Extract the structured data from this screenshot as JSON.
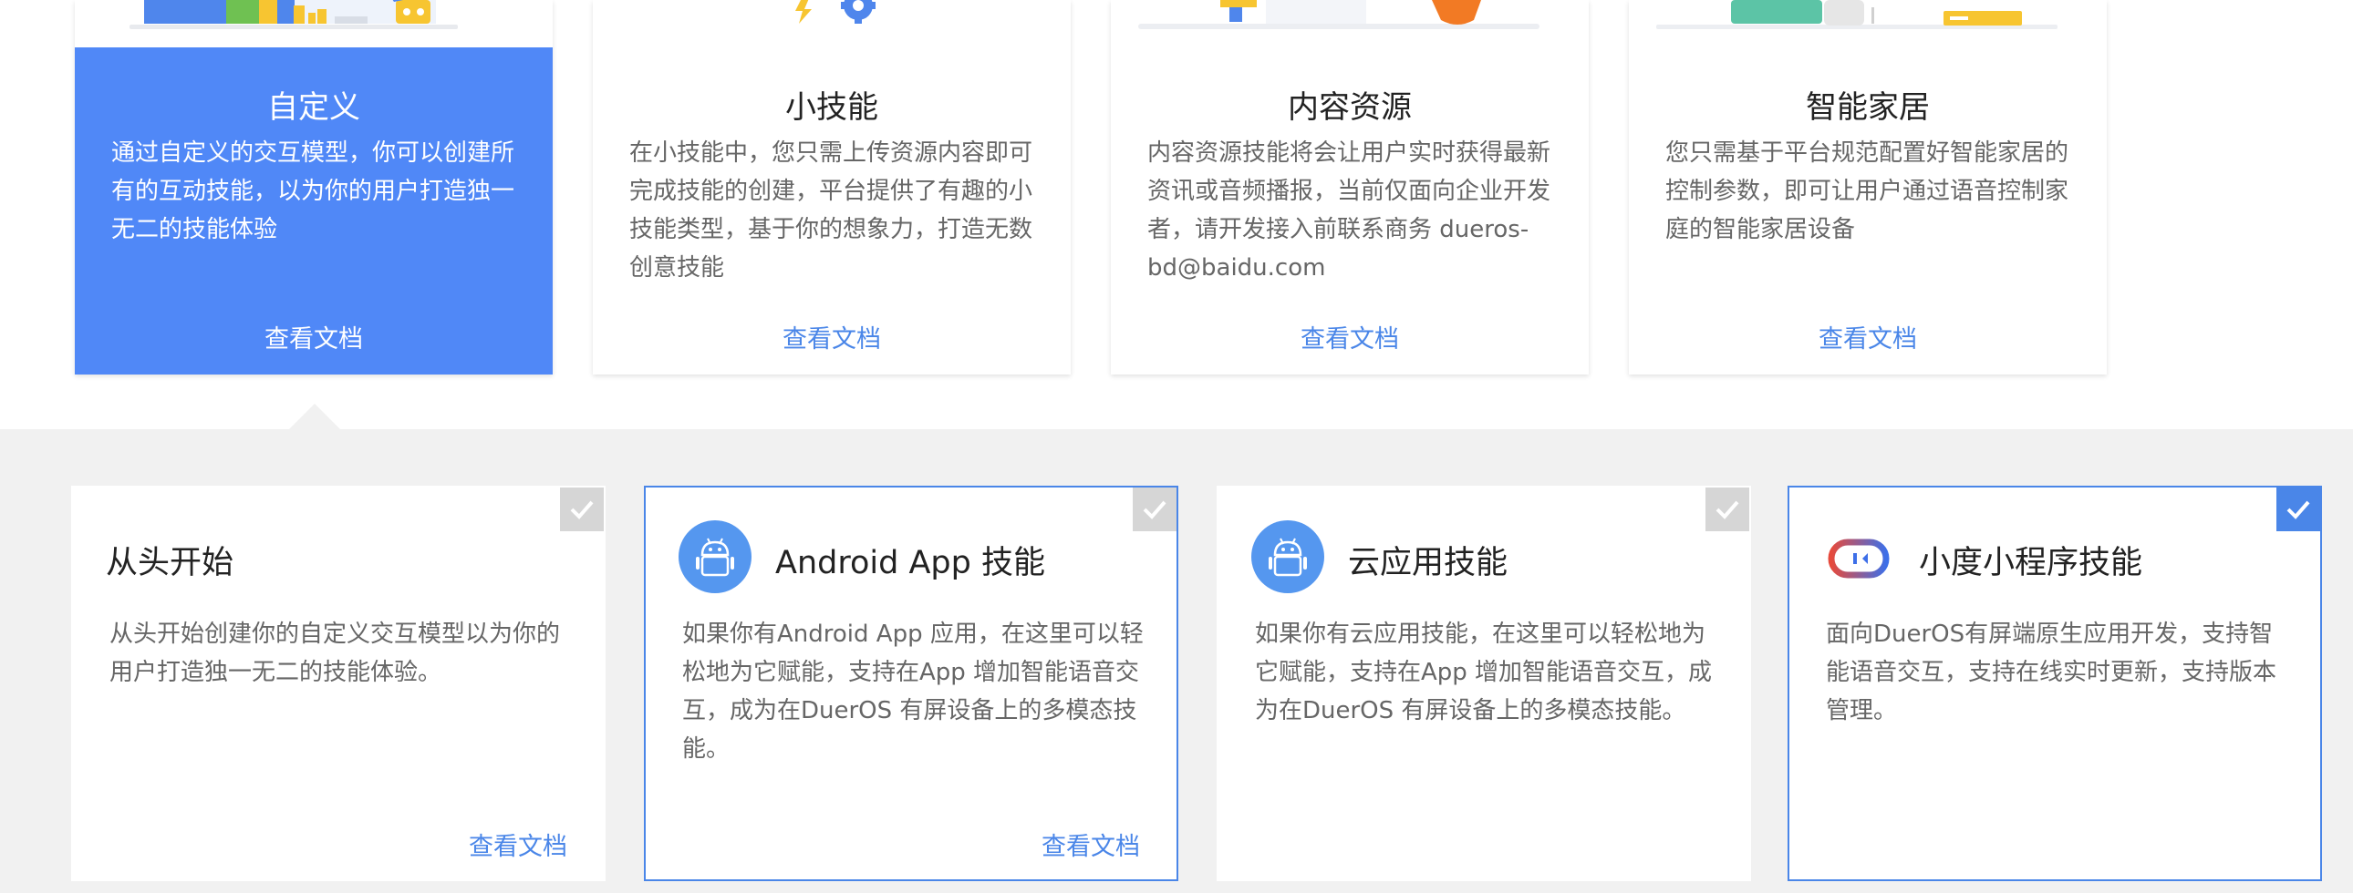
{
  "skill_types": [
    {
      "title": "自定义",
      "description": "通过自定义的交互模型，你可以创建所有的互动技能，以为你的用户打造独一无二的技能体验",
      "link": "查看文档",
      "active": true
    },
    {
      "title": "小技能",
      "description": "在小技能中，您只需上传资源内容即可完成技能的创建，平台提供了有趣的小技能类型，基于你的想象力，打造无数创意技能",
      "link": "查看文档"
    },
    {
      "title": "内容资源",
      "description": "内容资源技能将会让用户实时获得最新资讯或音频播报，当前仅面向企业开发者，请开发接入前联系商务 dueros-bd@baidu.com",
      "link": "查看文档"
    },
    {
      "title": "智能家居",
      "description": "您只需基于平台规范配置好智能家居的控制参数，即可让用户通过语音控制家庭的智能家居设备",
      "link": "查看文档"
    }
  ],
  "options": [
    {
      "title": "从头开始",
      "description": "从头开始创建你的自定义交互模型以为你的用户打造独一无二的技能体验。",
      "link": "查看文档",
      "icon": "none",
      "selected": false
    },
    {
      "title": "Android App 技能",
      "description": "如果你有Android App 应用，在这里可以轻松地为它赋能，支持在App 增加智能语音交互，成为在DuerOS 有屏设备上的多模态技能。",
      "link": "查看文档",
      "icon": "android-icon",
      "selected": true
    },
    {
      "title": "云应用技能",
      "description": "如果你有云应用技能，在这里可以轻松地为它赋能，支持在App 增加智能语音交互，成为在DuerOS 有屏设备上的多模态技能。",
      "link": "",
      "icon": "android-icon",
      "selected": false
    },
    {
      "title": "小度小程序技能",
      "description": "面向DuerOS有屏端原生应用开发，支持智能语音交互，支持在线实时更新，支持版本管理。",
      "link": "",
      "icon": "xiaodu-mini-program-icon",
      "selected": true
    }
  ],
  "colors": {
    "accent": "#4a86e8",
    "active_card": "#5088f7",
    "android_icon_bg": "#5597ef",
    "check_inactive": "#d6d6d6",
    "section_bg": "#f1f1f1"
  }
}
